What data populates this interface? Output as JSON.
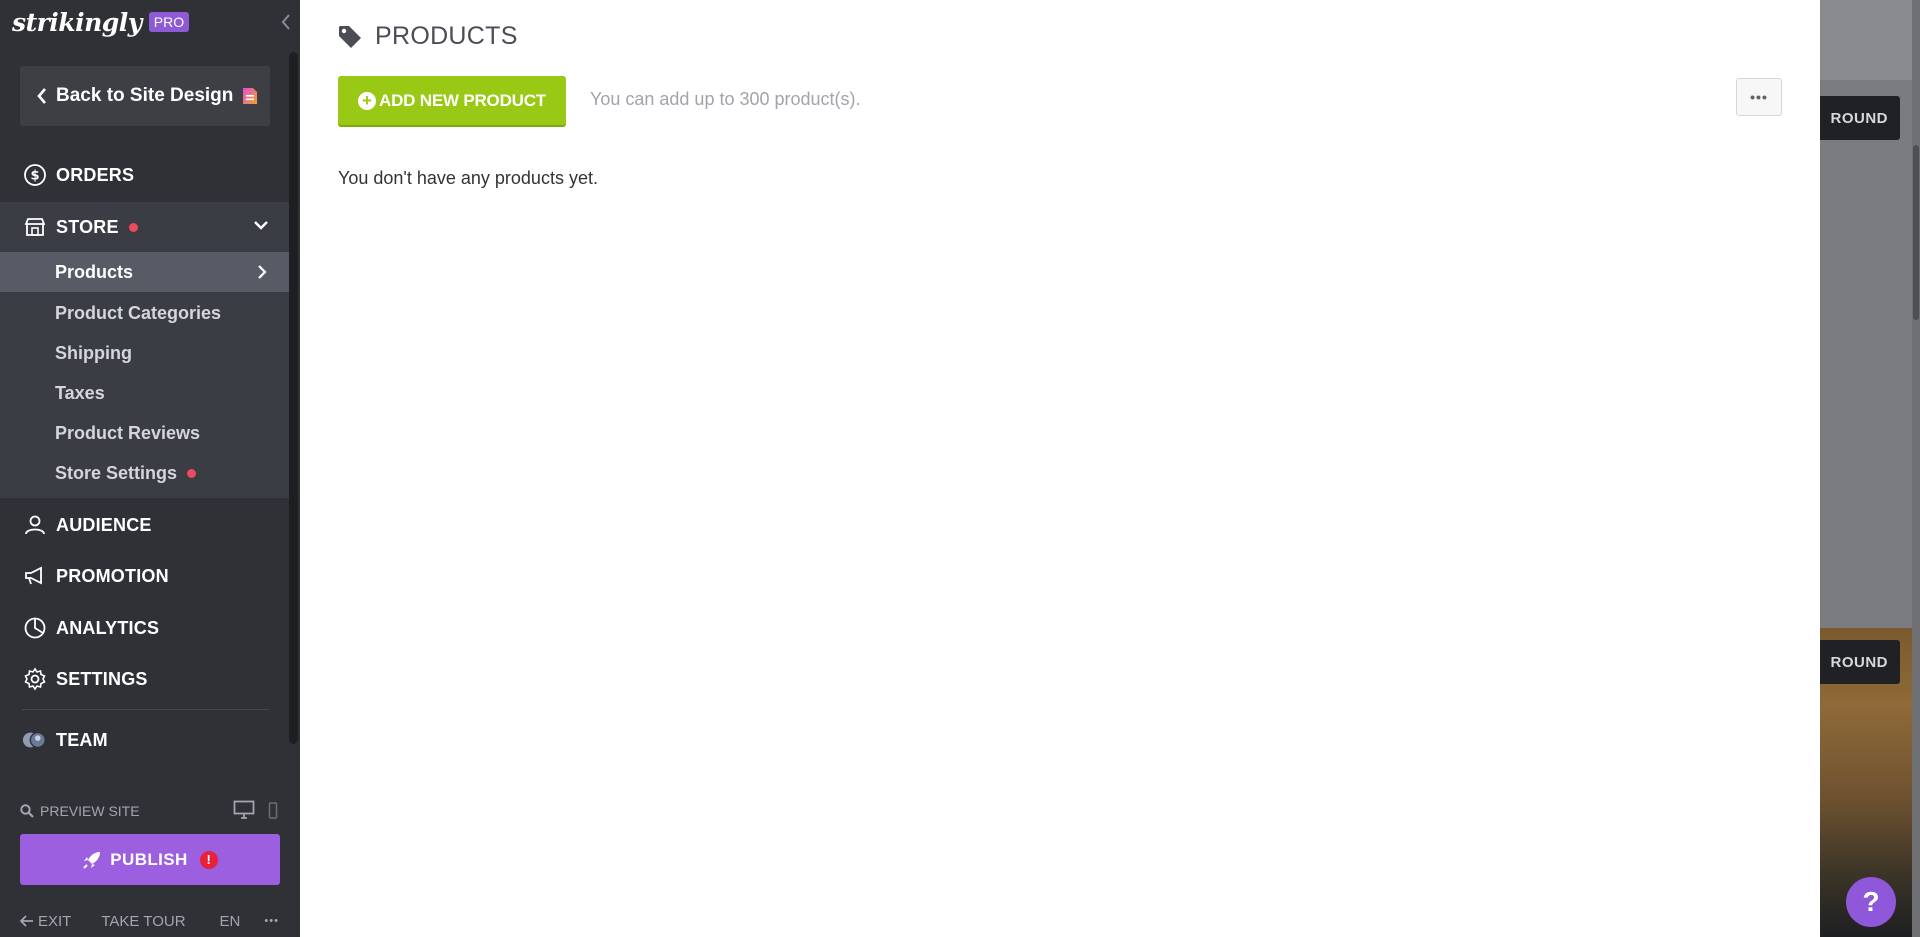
{
  "brand": {
    "logo_text": "strikingly",
    "badge": "PRO"
  },
  "sidebar": {
    "back_label": "Back to Site Design",
    "nav": {
      "orders": "ORDERS",
      "store": "STORE",
      "audience": "AUDIENCE",
      "promotion": "PROMOTION",
      "analytics": "ANALYTICS",
      "settings": "SETTINGS",
      "team": "TEAM"
    },
    "store_items": [
      {
        "label": "Products",
        "active": true
      },
      {
        "label": "Product Categories"
      },
      {
        "label": "Shipping"
      },
      {
        "label": "Taxes"
      },
      {
        "label": "Product Reviews"
      },
      {
        "label": "Store Settings",
        "notification": true
      }
    ],
    "preview_label": "PREVIEW SITE",
    "publish_label": "PUBLISH",
    "publish_warning": "!",
    "footer": {
      "exit": "EXIT",
      "tour": "TAKE TOUR",
      "lang": "EN",
      "more": "•••"
    }
  },
  "main": {
    "title": "PRODUCTS",
    "add_button": "ADD NEW PRODUCT",
    "limit_text": "You can add up to 300 product(s).",
    "more_button": "•••",
    "empty_text": "You don't have any products yet."
  },
  "preview": {
    "button_1": "ROUND",
    "button_2": "ROUND",
    "help": "?"
  },
  "colors": {
    "sidebar_bg": "#2f3136",
    "store_section_bg": "#3a3d44",
    "active_item_bg": "#575b65",
    "add_button": "#99c914",
    "publish_button": "#9b5fe0",
    "pro_badge": "#8e5ad6",
    "notification_dot": "#ee4a5b"
  },
  "icons": [
    "collapse-chevron-icon",
    "chevron-left-icon",
    "page-icon",
    "dollar-circle-icon",
    "store-icon",
    "chevron-down-icon",
    "chevron-right-icon",
    "user-icon",
    "megaphone-icon",
    "pie-chart-icon",
    "gear-icon",
    "team-avatar-icon",
    "search-icon",
    "desktop-icon",
    "mobile-icon",
    "rocket-icon",
    "arrow-left-icon",
    "tag-icon",
    "plus-circle-icon",
    "help-icon"
  ]
}
